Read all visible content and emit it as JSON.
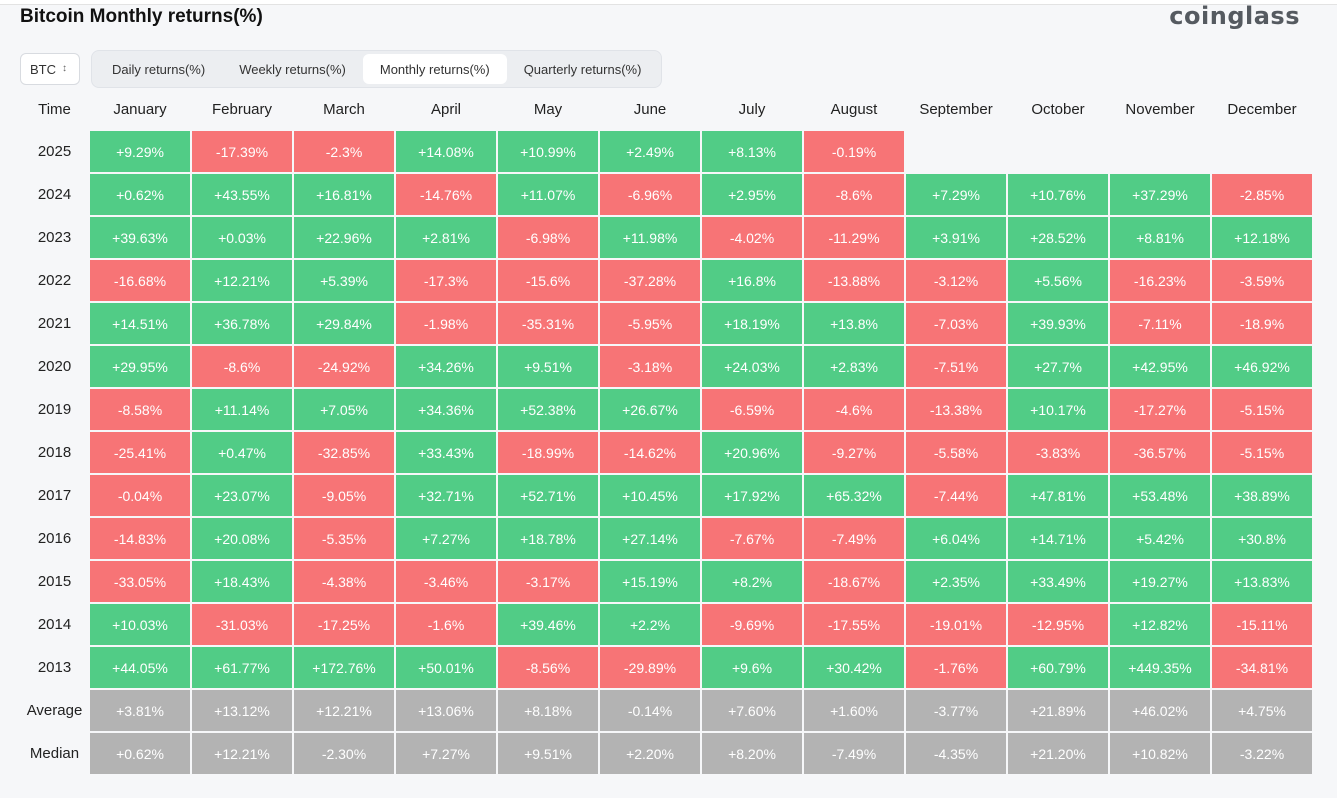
{
  "header": {
    "title": "Bitcoin Monthly returns(%)",
    "logo": "coinglass"
  },
  "coin_selector": {
    "value": "BTC"
  },
  "tabs": [
    {
      "label": "Daily returns(%)",
      "active": false
    },
    {
      "label": "Weekly returns(%)",
      "active": false
    },
    {
      "label": "Monthly returns(%)",
      "active": true
    },
    {
      "label": "Quarterly returns(%)",
      "active": false
    }
  ],
  "colors": {
    "positive": "#51cc86",
    "negative": "#f77476",
    "summary": "#b3b3b3"
  },
  "chart_data": {
    "type": "heatmap",
    "title": "Bitcoin Monthly returns(%)",
    "row_header": "Time",
    "columns": [
      "January",
      "February",
      "March",
      "April",
      "May",
      "June",
      "July",
      "August",
      "September",
      "October",
      "November",
      "December"
    ],
    "rows": [
      {
        "label": "2025",
        "values": [
          "+9.29%",
          "-17.39%",
          "-2.3%",
          "+14.08%",
          "+10.99%",
          "+2.49%",
          "+8.13%",
          "-0.19%",
          "",
          "",
          "",
          ""
        ]
      },
      {
        "label": "2024",
        "values": [
          "+0.62%",
          "+43.55%",
          "+16.81%",
          "-14.76%",
          "+11.07%",
          "-6.96%",
          "+2.95%",
          "-8.6%",
          "+7.29%",
          "+10.76%",
          "+37.29%",
          "-2.85%"
        ]
      },
      {
        "label": "2023",
        "values": [
          "+39.63%",
          "+0.03%",
          "+22.96%",
          "+2.81%",
          "-6.98%",
          "+11.98%",
          "-4.02%",
          "-11.29%",
          "+3.91%",
          "+28.52%",
          "+8.81%",
          "+12.18%"
        ]
      },
      {
        "label": "2022",
        "values": [
          "-16.68%",
          "+12.21%",
          "+5.39%",
          "-17.3%",
          "-15.6%",
          "-37.28%",
          "+16.8%",
          "-13.88%",
          "-3.12%",
          "+5.56%",
          "-16.23%",
          "-3.59%"
        ]
      },
      {
        "label": "2021",
        "values": [
          "+14.51%",
          "+36.78%",
          "+29.84%",
          "-1.98%",
          "-35.31%",
          "-5.95%",
          "+18.19%",
          "+13.8%",
          "-7.03%",
          "+39.93%",
          "-7.11%",
          "-18.9%"
        ]
      },
      {
        "label": "2020",
        "values": [
          "+29.95%",
          "-8.6%",
          "-24.92%",
          "+34.26%",
          "+9.51%",
          "-3.18%",
          "+24.03%",
          "+2.83%",
          "-7.51%",
          "+27.7%",
          "+42.95%",
          "+46.92%"
        ]
      },
      {
        "label": "2019",
        "values": [
          "-8.58%",
          "+11.14%",
          "+7.05%",
          "+34.36%",
          "+52.38%",
          "+26.67%",
          "-6.59%",
          "-4.6%",
          "-13.38%",
          "+10.17%",
          "-17.27%",
          "-5.15%"
        ]
      },
      {
        "label": "2018",
        "values": [
          "-25.41%",
          "+0.47%",
          "-32.85%",
          "+33.43%",
          "-18.99%",
          "-14.62%",
          "+20.96%",
          "-9.27%",
          "-5.58%",
          "-3.83%",
          "-36.57%",
          "-5.15%"
        ]
      },
      {
        "label": "2017",
        "values": [
          "-0.04%",
          "+23.07%",
          "-9.05%",
          "+32.71%",
          "+52.71%",
          "+10.45%",
          "+17.92%",
          "+65.32%",
          "-7.44%",
          "+47.81%",
          "+53.48%",
          "+38.89%"
        ]
      },
      {
        "label": "2016",
        "values": [
          "-14.83%",
          "+20.08%",
          "-5.35%",
          "+7.27%",
          "+18.78%",
          "+27.14%",
          "-7.67%",
          "-7.49%",
          "+6.04%",
          "+14.71%",
          "+5.42%",
          "+30.8%"
        ]
      },
      {
        "label": "2015",
        "values": [
          "-33.05%",
          "+18.43%",
          "-4.38%",
          "-3.46%",
          "-3.17%",
          "+15.19%",
          "+8.2%",
          "-18.67%",
          "+2.35%",
          "+33.49%",
          "+19.27%",
          "+13.83%"
        ]
      },
      {
        "label": "2014",
        "values": [
          "+10.03%",
          "-31.03%",
          "-17.25%",
          "-1.6%",
          "+39.46%",
          "+2.2%",
          "-9.69%",
          "-17.55%",
          "-19.01%",
          "-12.95%",
          "+12.82%",
          "-15.11%"
        ]
      },
      {
        "label": "2013",
        "values": [
          "+44.05%",
          "+61.77%",
          "+172.76%",
          "+50.01%",
          "-8.56%",
          "-29.89%",
          "+9.6%",
          "+30.42%",
          "-1.76%",
          "+60.79%",
          "+449.35%",
          "-34.81%"
        ]
      }
    ],
    "summary_rows": [
      {
        "label": "Average",
        "values": [
          "+3.81%",
          "+13.12%",
          "+12.21%",
          "+13.06%",
          "+8.18%",
          "-0.14%",
          "+7.60%",
          "+1.60%",
          "-3.77%",
          "+21.89%",
          "+46.02%",
          "+4.75%"
        ]
      },
      {
        "label": "Median",
        "values": [
          "+0.62%",
          "+12.21%",
          "-2.30%",
          "+7.27%",
          "+9.51%",
          "+2.20%",
          "+8.20%",
          "-7.49%",
          "-4.35%",
          "+21.20%",
          "+10.82%",
          "-3.22%"
        ]
      }
    ]
  }
}
